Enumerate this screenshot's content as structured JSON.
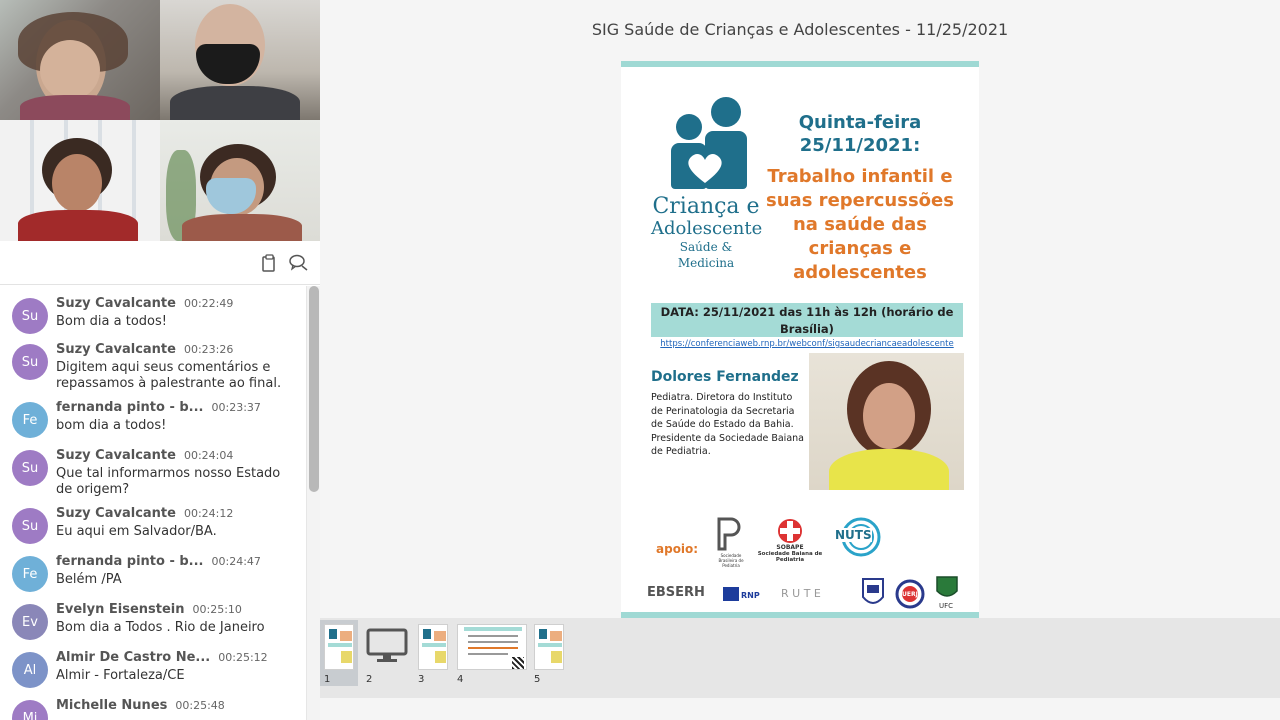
{
  "presentation": {
    "title": "SIG Saúde de Crianças e Adolescentes - 11/25/2021"
  },
  "toolbar": {
    "copy_icon": "clipboard-icon",
    "chat_icon": "chat-icon"
  },
  "chat": {
    "messages": [
      {
        "initials": "Su",
        "name": "Suzy Cavalcante",
        "time": "00:22:49",
        "text": "Bom dia a todos!",
        "color": "#9e7bc4"
      },
      {
        "initials": "Su",
        "name": "Suzy Cavalcante",
        "time": "00:23:26",
        "text": "Digitem aqui seus comentários e repassamos à palestrante ao final.",
        "color": "#9e7bc4"
      },
      {
        "initials": "Fe",
        "name": "fernanda pinto - b...",
        "time": "00:23:37",
        "text": "bom dia a todos!",
        "color": "#6fb0d8"
      },
      {
        "initials": "Su",
        "name": "Suzy Cavalcante",
        "time": "00:24:04",
        "text": "Que tal informarmos nosso Estado de origem?",
        "color": "#9e7bc4"
      },
      {
        "initials": "Su",
        "name": "Suzy Cavalcante",
        "time": "00:24:12",
        "text": "Eu aqui em Salvador/BA.",
        "color": "#9e7bc4"
      },
      {
        "initials": "Fe",
        "name": "fernanda pinto - b...",
        "time": "00:24:47",
        "text": "Belém /PA",
        "color": "#6fb0d8"
      },
      {
        "initials": "Ev",
        "name": "Evelyn Eisenstein",
        "time": "00:25:10",
        "text": "Bom dia a Todos . Rio de Janeiro",
        "color": "#8a87b8"
      },
      {
        "initials": "Al",
        "name": "Almir De Castro Ne...",
        "time": "00:25:12",
        "text": "Almir - Fortaleza/CE",
        "color": "#7d93c8"
      },
      {
        "initials": "Mi",
        "name": "Michelle Nunes",
        "time": "00:25:48",
        "text": "",
        "color": "#9e7bc4"
      }
    ]
  },
  "slide": {
    "logo_line1": "Criança e",
    "logo_line2": "Adolescente",
    "logo_line3": "Saúde & Medicina",
    "day": "Quinta-feira 25/11/2021:",
    "topic": "Trabalho infantil e suas repercussões na saúde das crianças e adolescentes",
    "date_line": "DATA: 25/11/2021 das 11h às 12h (horário de Brasília)",
    "date_link": "https://conferenciaweb.rnp.br/webconf/sigsaudecriancaeadolescente",
    "speaker_name": "Dolores Fernandez",
    "speaker_bio": "Pediatra. Diretora do Instituto de Perinatologia da Secretaria de Saúde do Estado da Bahia. Presidente da Sociedade Baiana de Pediatria.",
    "apoio": "apoio:",
    "partner_sbp": "Sociedade Brasileira de Pediatria",
    "partner_sobape_1": "SOBAPE",
    "partner_sobape_2": "Sociedade Baiana de Pediatria",
    "partner_nuts": "NUTS",
    "partner_ebserh": "EBSERH",
    "partner_rnp": "RNP",
    "partner_rute": "R U T E",
    "partner_uerj": "UERJ",
    "partner_ufc": "UFC"
  },
  "thumbnails": [
    {
      "num": "1",
      "active": true
    },
    {
      "num": "2",
      "active": false
    },
    {
      "num": "3",
      "active": false
    },
    {
      "num": "4",
      "active": false
    },
    {
      "num": "5",
      "active": false
    }
  ]
}
